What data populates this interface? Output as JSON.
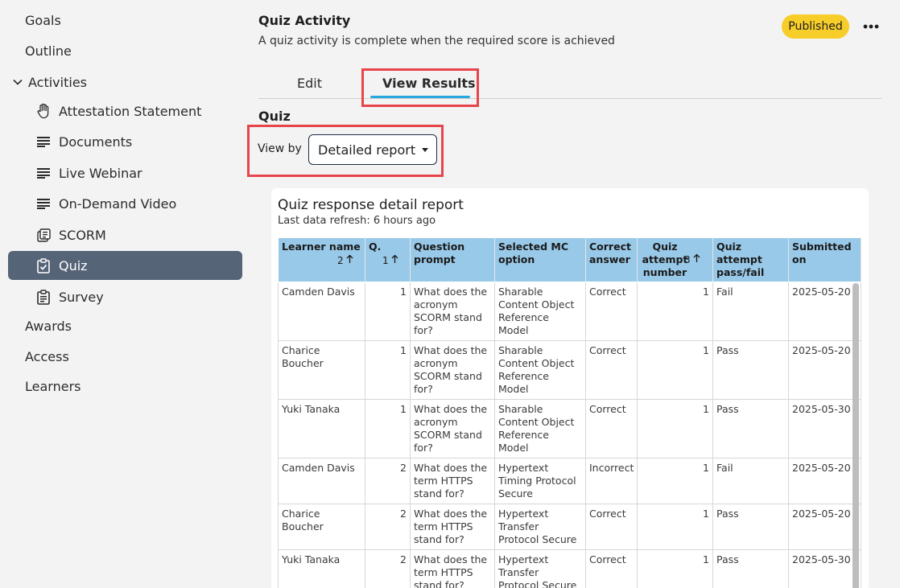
{
  "sidebar": {
    "goals": "Goals",
    "outline": "Outline",
    "activities": "Activities",
    "activity_items": [
      {
        "label": "Attestation Statement",
        "icon": "hand-icon"
      },
      {
        "label": "Documents",
        "icon": "lines-icon"
      },
      {
        "label": "Live Webinar",
        "icon": "lines-icon"
      },
      {
        "label": "On-Demand Video",
        "icon": "lines-icon"
      },
      {
        "label": "SCORM",
        "icon": "package-icon"
      },
      {
        "label": "Quiz",
        "icon": "clipboard-check-icon"
      },
      {
        "label": "Survey",
        "icon": "clipboard-list-icon"
      }
    ],
    "awards": "Awards",
    "access": "Access",
    "learners": "Learners"
  },
  "header": {
    "title": "Quiz Activity",
    "subtitle": "A quiz activity is complete when the required score is achieved",
    "status_badge": "Published"
  },
  "tabs": {
    "edit": "Edit",
    "view_results": "View Results"
  },
  "section_title": "Quiz",
  "view_by": {
    "label": "View by",
    "selected": "Detailed report"
  },
  "report": {
    "title": "Quiz response detail report",
    "refresh": "Last data refresh: 6 hours ago",
    "columns": [
      "Learner name",
      "Q.",
      "Question prompt",
      "Selected MC option",
      "Correct answer",
      "Quiz attempt number",
      "Quiz attempt pass/fail",
      "Submitted on"
    ],
    "sort_indicators": {
      "learner": "2",
      "q": "1",
      "attempt": "3"
    },
    "rows": [
      [
        "Camden Davis",
        "1",
        "What does the acronym SCORM stand for?",
        "Sharable Content Object Reference Model",
        "Correct",
        "1",
        "Fail",
        "2025-05-20"
      ],
      [
        "Charice Boucher",
        "1",
        "What does the acronym SCORM stand for?",
        "Sharable Content Object Reference Model",
        "Correct",
        "1",
        "Pass",
        "2025-05-20"
      ],
      [
        "Yuki Tanaka",
        "1",
        "What does the acronym SCORM stand for?",
        "Sharable Content Object Reference Model",
        "Correct",
        "1",
        "Pass",
        "2025-05-30"
      ],
      [
        "Camden Davis",
        "2",
        "What does the term HTTPS stand for?",
        "Hypertext Timing Protocol Secure",
        "Incorrect",
        "1",
        "Fail",
        "2025-05-20"
      ],
      [
        "Charice Boucher",
        "2",
        "What does the term HTTPS stand for?",
        "Hypertext Transfer Protocol Secure",
        "Correct",
        "1",
        "Pass",
        "2025-05-20"
      ],
      [
        "Yuki Tanaka",
        "2",
        "What does the term HTTPS stand for?",
        "Hypertext Transfer Protocol Secure",
        "Correct",
        "1",
        "Pass",
        "2025-05-30"
      ]
    ]
  },
  "colors": {
    "active_nav": "#566478",
    "badge": "#f7cd2a",
    "tab_underline": "#29a8e0",
    "header_row": "#99c9e8",
    "highlight": "#e8454b"
  }
}
